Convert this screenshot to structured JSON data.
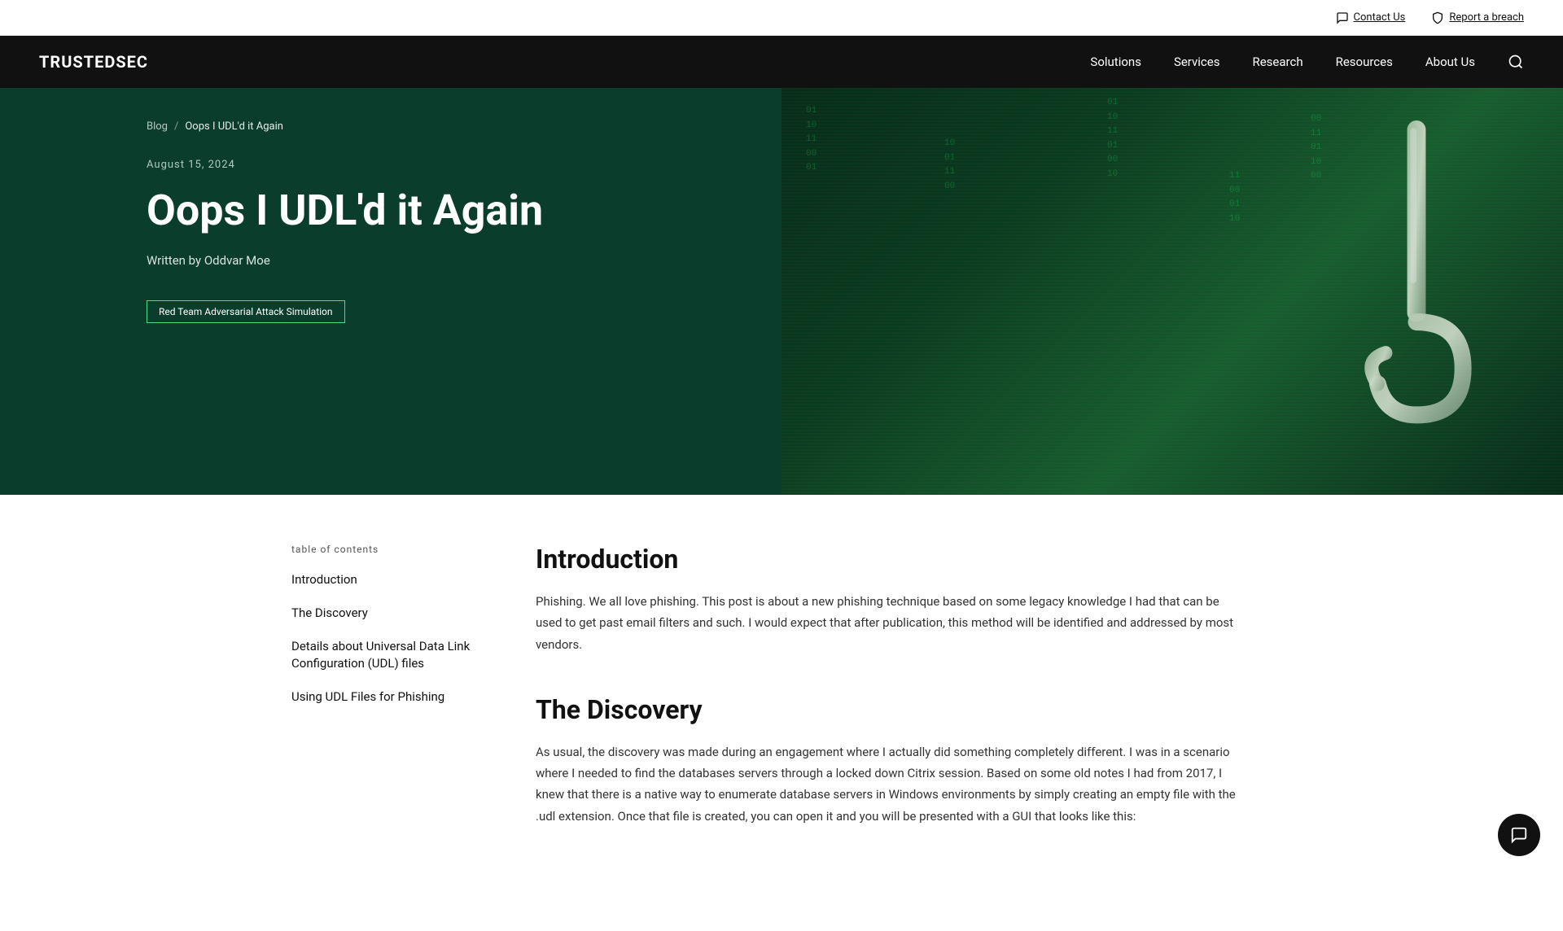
{
  "brand": {
    "logo": "TRUSTEDSEC"
  },
  "utility_bar": {
    "contact_label": "Contact Us",
    "report_label": "Report a breach"
  },
  "navbar": {
    "items": [
      {
        "id": "solutions",
        "label": "Solutions"
      },
      {
        "id": "services",
        "label": "Services"
      },
      {
        "id": "research",
        "label": "Research"
      },
      {
        "id": "resources",
        "label": "Resources"
      },
      {
        "id": "about-us",
        "label": "About Us"
      }
    ]
  },
  "hero": {
    "breadcrumb_blog": "Blog",
    "breadcrumb_sep": "/",
    "breadcrumb_current": "Oops I UDL'd it Again",
    "date": "August 15, 2024",
    "title": "Oops I UDL'd it Again",
    "author_prefix": "Written by ",
    "author": "Oddvar Moe",
    "tag": "Red Team Adversarial Attack Simulation"
  },
  "toc": {
    "label": "Table of contents",
    "items": [
      {
        "id": "introduction",
        "label": "Introduction"
      },
      {
        "id": "discovery",
        "label": "The Discovery"
      },
      {
        "id": "udl-details",
        "label": "Details about Universal Data Link Configuration (UDL) files"
      },
      {
        "id": "using-udl",
        "label": "Using UDL Files for Phishing"
      }
    ]
  },
  "article": {
    "sections": [
      {
        "id": "introduction",
        "heading": "Introduction",
        "body": "Phishing. We all love phishing. This post is about a new phishing technique based on some legacy knowledge I had that can be used to get past email filters and such. I would expect that after publication, this method will be identified and addressed by most vendors."
      },
      {
        "id": "discovery",
        "heading": "The Discovery",
        "body": "As usual, the discovery was made during an engagement where I actually did something completely different. I was in a scenario where I needed to find the databases servers through a locked down Citrix session. Based on some old notes I had from 2017, I knew that there is a native way to enumerate database servers in Windows environments by simply creating an empty file with the .udl extension. Once that file is created, you can open it and you will be presented with a GUI that looks like this:"
      }
    ]
  }
}
